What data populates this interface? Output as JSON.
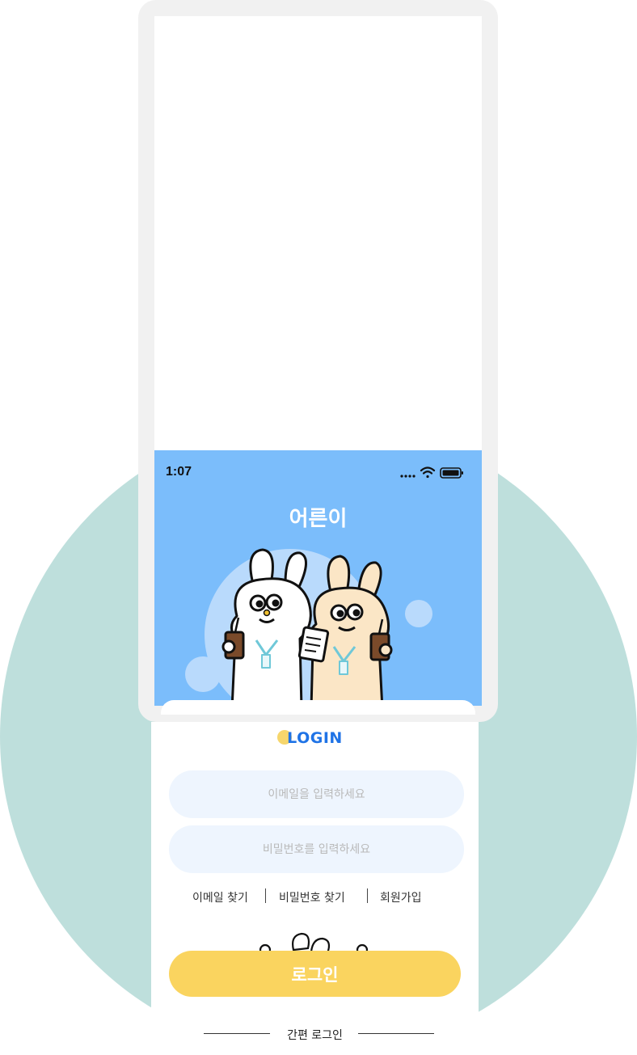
{
  "status_bar": {
    "time": "1:07",
    "icons": [
      "signal-dots-icon",
      "wifi-icon",
      "battery-icon"
    ]
  },
  "app": {
    "title": "어른이"
  },
  "login": {
    "heading": "LOGIN",
    "email_placeholder": "이메일을 입력하세요",
    "password_placeholder": "비밀번호를 입력하세요",
    "links": [
      "이메일 찾기",
      "비밀번호 찾기",
      "회원가입"
    ],
    "button_label": "로그인",
    "easy_login_label": "간편 로그인"
  },
  "colors": {
    "background_circle": "#bedfdc",
    "header_blue": "#7bbdfb",
    "input_fill": "#eef5fe",
    "button_yellow": "#fad45f",
    "heading_blue": "#1f73e6"
  }
}
